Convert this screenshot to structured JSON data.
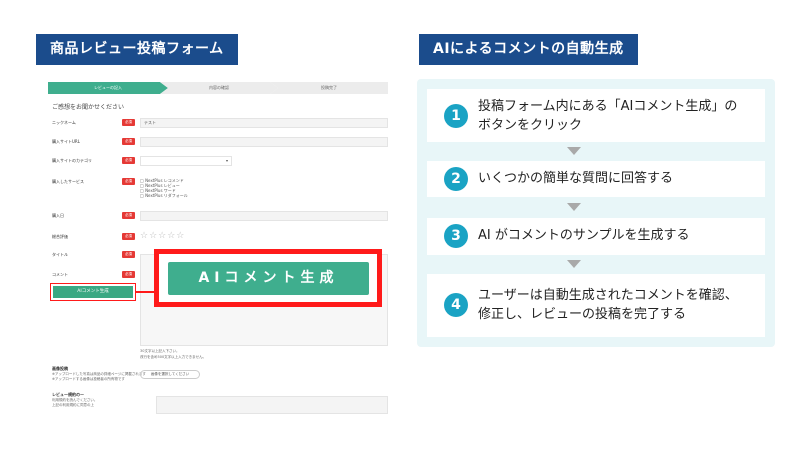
{
  "left_header": "商品レビュー投稿フォーム",
  "right_header": "AIによるコメントの自動生成",
  "form": {
    "steps": [
      "レビューの記入",
      "内容の確認",
      "投稿完了"
    ],
    "heading": "ご感想をお聞かせください",
    "required_badge": "必須",
    "fields": {
      "nickname": {
        "label": "ニックネーム",
        "value": "テスト"
      },
      "site_url": {
        "label": "購入サイトURL"
      },
      "site_category": {
        "label": "購入サイトのカテゴリ",
        "arrow": "▾"
      },
      "service": {
        "label": "購入したサービス",
        "options": [
          "NextPlus レコメンド",
          "NextPlus レビュー",
          "NextPlus ワード",
          "NextPlus リダフォール"
        ]
      },
      "purchase_date": {
        "label": "購入日"
      },
      "rating": {
        "label": "総合評価",
        "stars": "☆☆☆☆☆"
      },
      "title": {
        "label": "タイトル"
      },
      "comment": {
        "label": "コメント"
      }
    },
    "ai_button_small": "AIコメント生成",
    "ai_button_big": "AIコメント生成",
    "comment_notes": [
      "30文字以上記入下さい。",
      "改行を含め500文字以上入力できません。"
    ],
    "image_upload": {
      "label": "画像投稿",
      "notes": [
        "※アップロードした写真は商品の詳細ページに掲載されます",
        "※アップロードする画像は投稿者の所有物です"
      ]
    },
    "image_button": "画像を選択してください",
    "review_agreement": {
      "label": "レビュー規約のー",
      "notes": [
        "利用規約を読んでください。",
        "上記の利用規約に同意の上"
      ]
    }
  },
  "steps": [
    {
      "num": "1",
      "lines": [
        "投稿フォーム内にある「AIコメント生成」の",
        "ボタンをクリック"
      ]
    },
    {
      "num": "2",
      "lines": [
        "いくつかの簡単な質問に回答する"
      ]
    },
    {
      "num": "3",
      "lines": [
        "AI がコメントのサンプルを生成する"
      ]
    },
    {
      "num": "4",
      "lines": [
        "ユーザーは自動生成されたコメントを確認、",
        "修正し、レビューの投稿を完了する"
      ]
    }
  ],
  "colors": {
    "header_bg": "#1b4c8c",
    "accent_green": "#3fae8e",
    "highlight_red": "#ff1a1a",
    "panel_bg": "#e8f6f8",
    "step_number": "#1aa3c4"
  }
}
